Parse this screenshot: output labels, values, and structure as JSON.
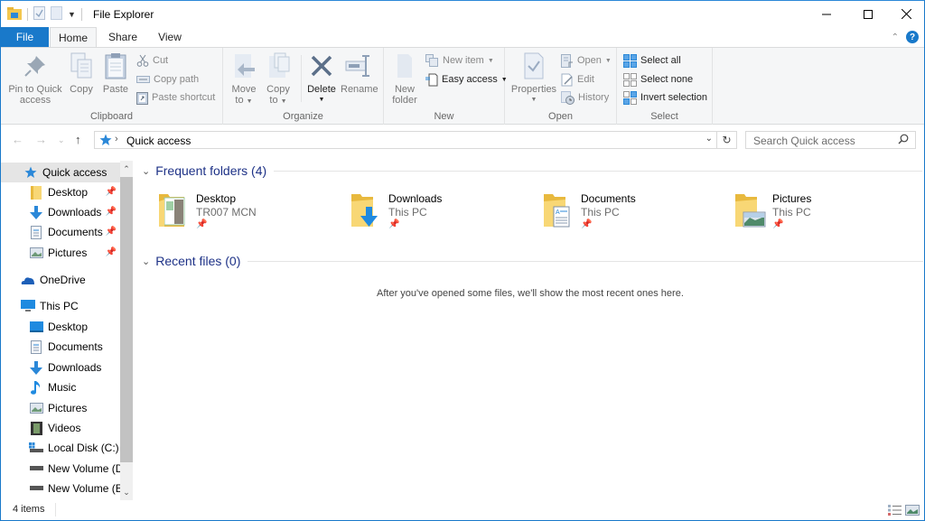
{
  "window": {
    "title": "File Explorer",
    "controls": {
      "minimize": "minimize-icon",
      "maximize": "maximize-icon",
      "close": "close-icon"
    }
  },
  "ribbon_tabs": [
    "File",
    "Home",
    "Share",
    "View"
  ],
  "active_tab": "Home",
  "ribbon": {
    "clipboard": {
      "label": "Clipboard",
      "pin": "Pin to Quick",
      "pin2": "access",
      "copy": "Copy",
      "paste": "Paste",
      "cut": "Cut",
      "copy_path": "Copy path",
      "paste_shortcut": "Paste shortcut"
    },
    "organize": {
      "label": "Organize",
      "move_to": "Move",
      "move_to2": "to",
      "copy_to": "Copy",
      "copy_to2": "to",
      "delete": "Delete",
      "rename": "Rename"
    },
    "new": {
      "label": "New",
      "new_folder": "New",
      "new_folder2": "folder",
      "new_item": "New item",
      "easy_access": "Easy access"
    },
    "open": {
      "label": "Open",
      "properties": "Properties",
      "open": "Open",
      "edit": "Edit",
      "history": "History"
    },
    "select": {
      "label": "Select",
      "select_all": "Select all",
      "select_none": "Select none",
      "invert": "Invert selection"
    }
  },
  "address": {
    "path": "Quick access",
    "search_placeholder": "Search Quick access"
  },
  "sidebar": {
    "quick_access": "Quick access",
    "qa_items": [
      {
        "label": "Desktop",
        "icon": "desktop-folder-icon",
        "pinned": true
      },
      {
        "label": "Downloads",
        "icon": "downloads-icon",
        "pinned": true
      },
      {
        "label": "Documents",
        "icon": "documents-icon",
        "pinned": true
      },
      {
        "label": "Pictures",
        "icon": "pictures-icon",
        "pinned": true
      }
    ],
    "onedrive": "OneDrive",
    "this_pc": "This PC",
    "pc_items": [
      {
        "label": "Desktop",
        "icon": "desktop-icon"
      },
      {
        "label": "Documents",
        "icon": "documents-icon"
      },
      {
        "label": "Downloads",
        "icon": "downloads-icon"
      },
      {
        "label": "Music",
        "icon": "music-icon"
      },
      {
        "label": "Pictures",
        "icon": "pictures-icon"
      },
      {
        "label": "Videos",
        "icon": "videos-icon"
      },
      {
        "label": "Local Disk (C:)",
        "icon": "local-disk-icon"
      },
      {
        "label": "New Volume (D:)",
        "icon": "drive-icon"
      },
      {
        "label": "New Volume (E:)",
        "icon": "drive-icon"
      }
    ]
  },
  "content": {
    "frequent_header": "Frequent folders (4)",
    "frequent": [
      {
        "name": "Desktop",
        "location": "TR007 MCN"
      },
      {
        "name": "Downloads",
        "location": "This PC"
      },
      {
        "name": "Documents",
        "location": "This PC"
      },
      {
        "name": "Pictures",
        "location": "This PC"
      }
    ],
    "recent_header": "Recent files (0)",
    "recent_empty": "After you've opened some files, we'll show the most recent ones here."
  },
  "status": {
    "count": "4 items"
  },
  "colors": {
    "accent": "#1979ca",
    "section_header": "#1e3287",
    "folder": "#f3d27a"
  }
}
